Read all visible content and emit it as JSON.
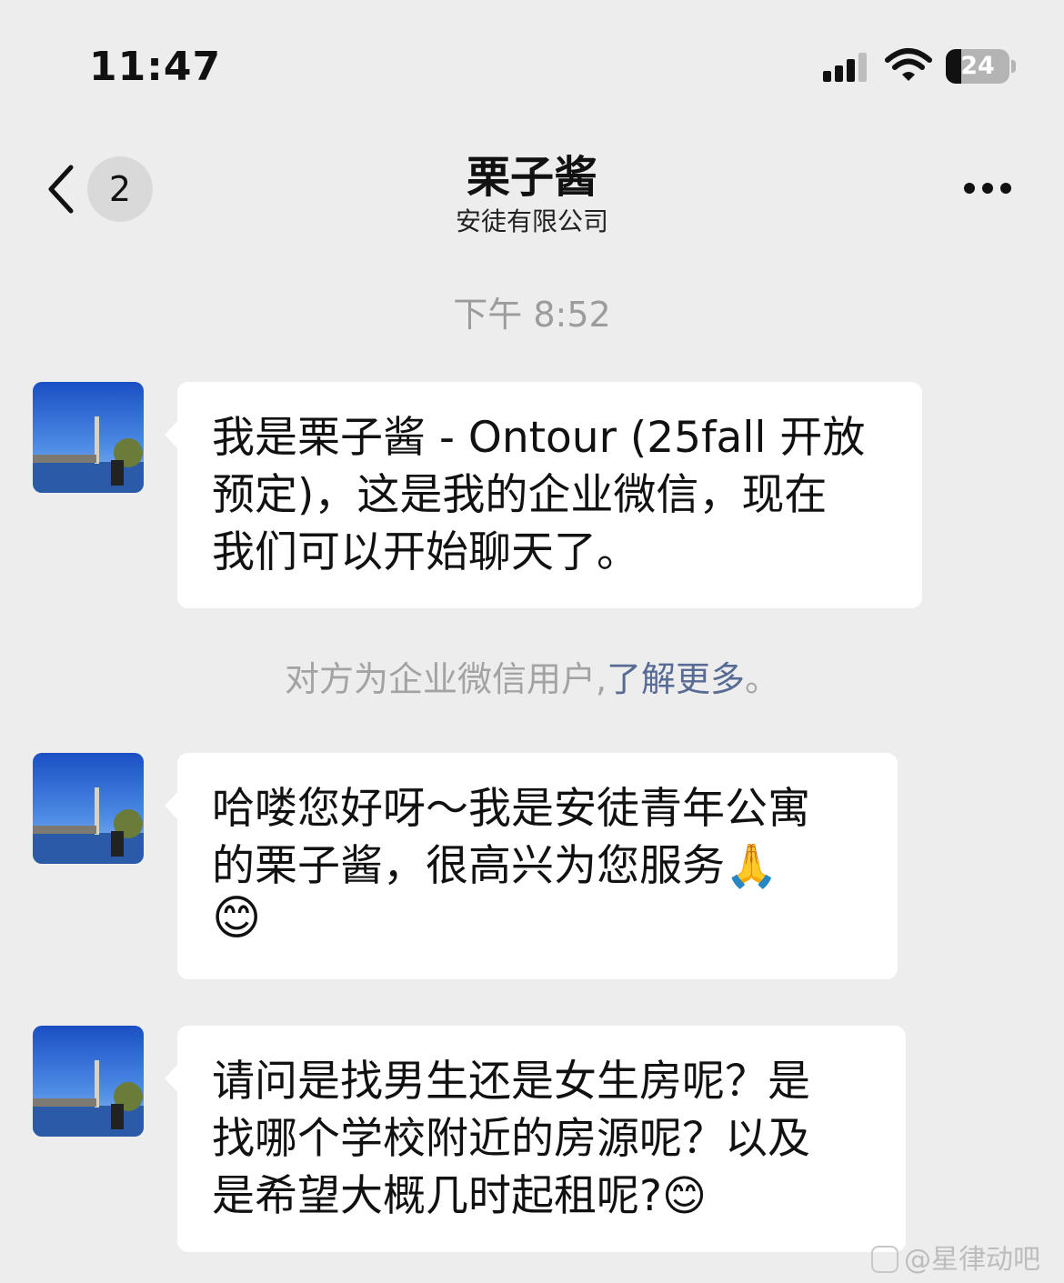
{
  "status_bar": {
    "time": "11:47",
    "battery_level": "24",
    "icons": [
      "cellular-signal-icon",
      "wifi-icon",
      "battery-icon"
    ]
  },
  "nav": {
    "unread_count": "2",
    "title": "栗子酱",
    "subtitle": "安徒有限公司",
    "icons": [
      "chevron-left-icon",
      "more-icon"
    ]
  },
  "timestamp": "下午 8:52",
  "messages": [
    {
      "lines": [
        "我是栗子酱 - Ontour (25fall 开放",
        "预定)，这是我的企业微信，现在",
        "我们可以开始聊天了。"
      ]
    },
    {
      "lines": [
        "哈喽您好呀～我是安徒青年公寓",
        "的栗子酱，很高兴为您服务🙏",
        "😊"
      ]
    },
    {
      "lines": [
        "请问是找男生还是女生房呢？是",
        "找哪个学校附近的房源呢？以及",
        "是希望大概几时起租呢?😊"
      ]
    }
  ],
  "system_notice": {
    "text": "对方为企业微信用户,",
    "link": "了解更多",
    "suffix": "。"
  },
  "watermark": "@星律动吧",
  "colors": {
    "background": "#ededed",
    "bubble": "#ffffff",
    "link": "#576b95",
    "muted_text": "#a3a3a3"
  }
}
